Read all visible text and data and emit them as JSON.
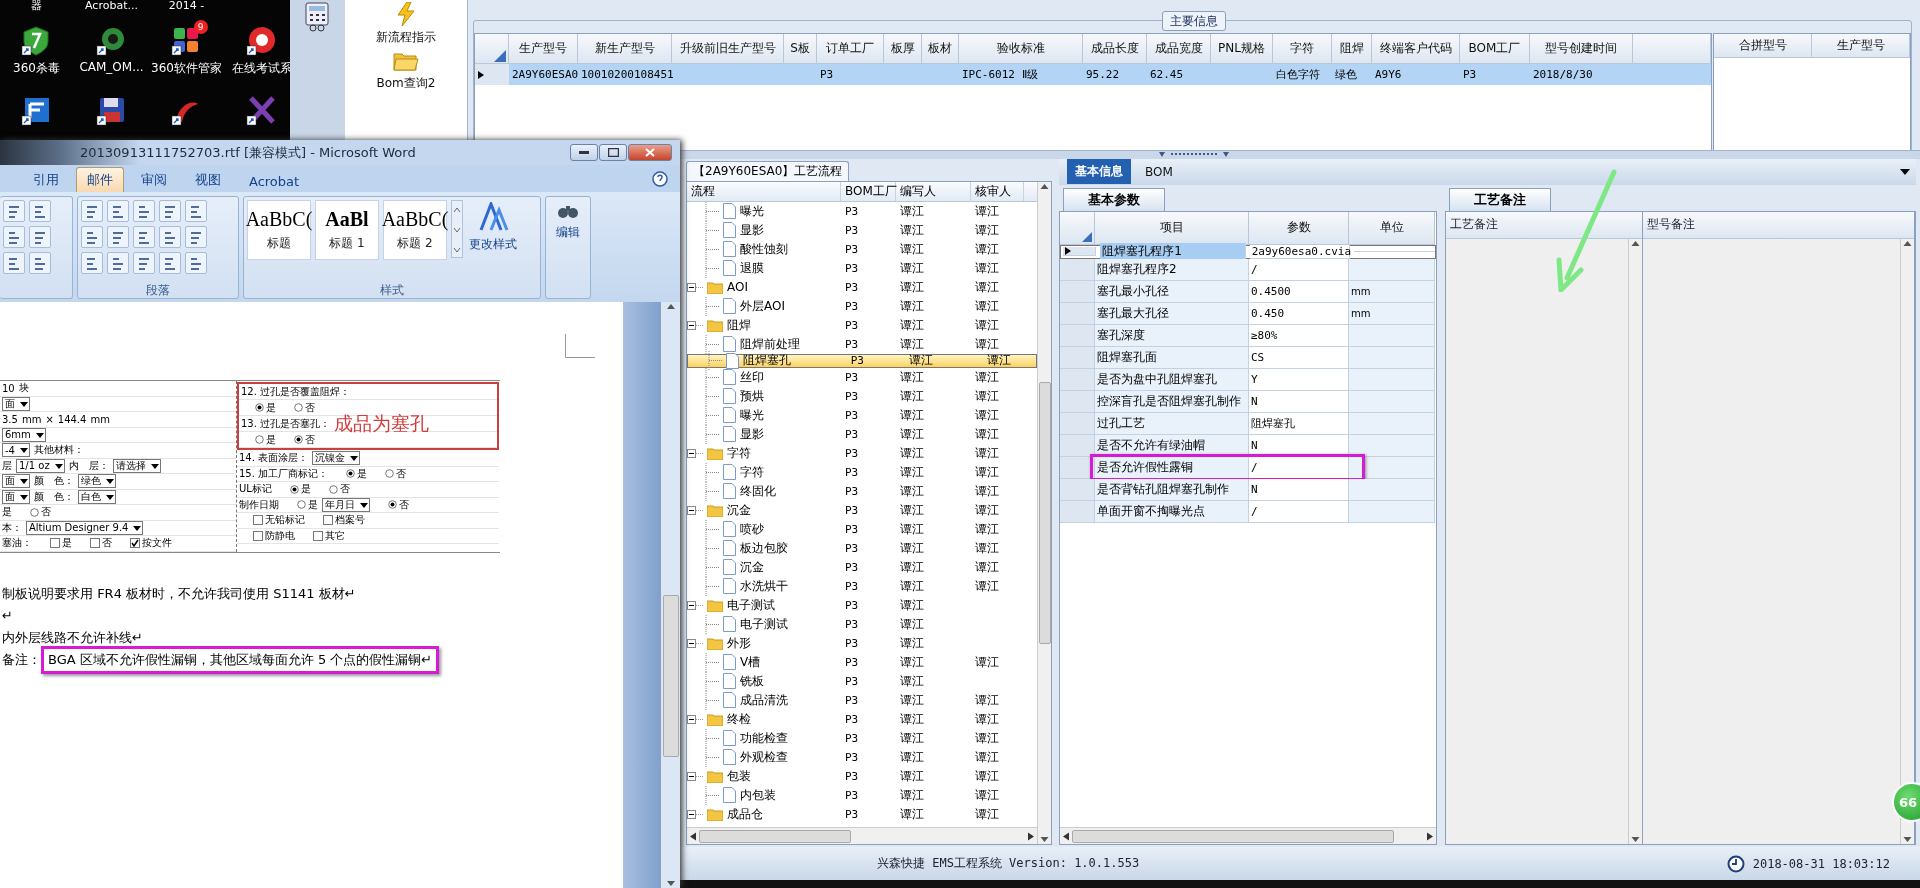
{
  "desktop": {
    "top_labels": [
      "器",
      "Acrobat...",
      "2014 -"
    ],
    "icons": [
      {
        "kind": "shield",
        "label": "360杀毒"
      },
      {
        "kind": "cam",
        "label": "CAM_OM..."
      },
      {
        "kind": "apps",
        "label": "360软件管家",
        "badge": "9"
      },
      {
        "kind": "exam",
        "label": "在线考试系"
      },
      {
        "kind": "edge"
      },
      {
        "kind": "floppy"
      },
      {
        "kind": "swirl"
      },
      {
        "kind": "cross"
      }
    ]
  },
  "app": {
    "toolbar": [
      {
        "kind": "calculator"
      },
      {
        "kind": "flash",
        "label": "新流程指示"
      },
      {
        "kind": "folder",
        "label": "Bom查询2"
      }
    ],
    "main_info": {
      "title": "主要信息",
      "columns": [
        "生产型号",
        "新生产型号",
        "升级前旧生产型号",
        "S板",
        "订单工厂",
        "板厚",
        "板材",
        "验收标准",
        "成品长度",
        "成品宽度",
        "PNL规格",
        "字符",
        "阻焊",
        "终端客户代码",
        "BOM工厂",
        "型号创建时间"
      ],
      "rows": [
        {
          "selected": true,
          "cells": [
            "2A9Y60ESA0",
            "10010200108451",
            null,
            null,
            "P3",
            null,
            null,
            "IPC-6012 Ⅱ级",
            "95.22",
            "62.45",
            null,
            "白色字符",
            "绿色",
            "A9Y6",
            "P3",
            "2018/8/30"
          ]
        }
      ]
    },
    "merge_table": {
      "columns": [
        "合拼型号",
        "生产型号"
      ]
    },
    "process": {
      "title": "【2A9Y60ESA0】工艺流程",
      "columns": [
        "流程",
        "BOM工厂",
        "编写人",
        "核审人"
      ],
      "nodes": [
        {
          "kind": "file",
          "label": "曝光",
          "bom": "P3",
          "writer": "谭江",
          "reviewer": "谭江",
          "selected": false
        },
        {
          "kind": "file",
          "label": "显影",
          "bom": "P3",
          "writer": "谭江",
          "reviewer": "谭江",
          "selected": false
        },
        {
          "kind": "file",
          "label": "酸性蚀刻",
          "bom": "P3",
          "writer": "谭江",
          "reviewer": "谭江",
          "selected": false
        },
        {
          "kind": "file",
          "label": "退膜",
          "bom": "P3",
          "writer": "谭江",
          "reviewer": "谭江",
          "selected": false
        },
        {
          "kind": "folder",
          "label": "AOI",
          "bom": "P3",
          "writer": "谭江",
          "reviewer": "谭江",
          "selected": false,
          "expanded": true,
          "children": [
            {
              "kind": "file",
              "label": "外层AOI",
              "bom": "P3",
              "writer": "谭江",
              "reviewer": "谭江",
              "selected": false
            }
          ]
        },
        {
          "kind": "folder",
          "label": "阻焊",
          "bom": "P3",
          "writer": "谭江",
          "reviewer": "谭江",
          "selected": false,
          "expanded": true,
          "children": [
            {
              "kind": "file",
              "label": "阻焊前处理",
              "bom": "P3",
              "writer": "谭江",
              "reviewer": "谭江",
              "selected": false
            },
            {
              "kind": "file",
              "label": "阻焊塞孔",
              "bom": "P3",
              "writer": "谭江",
              "reviewer": "谭江",
              "selected": true
            },
            {
              "kind": "file",
              "label": "丝印",
              "bom": "P3",
              "writer": "谭江",
              "reviewer": "谭江",
              "selected": false
            },
            {
              "kind": "file",
              "label": "预烘",
              "bom": "P3",
              "writer": "谭江",
              "reviewer": "谭江",
              "selected": false
            },
            {
              "kind": "file",
              "label": "曝光",
              "bom": "P3",
              "writer": "谭江",
              "reviewer": "谭江",
              "selected": false
            },
            {
              "kind": "file",
              "label": "显影",
              "bom": "P3",
              "writer": "谭江",
              "reviewer": "谭江",
              "selected": false
            }
          ]
        },
        {
          "kind": "folder",
          "label": "字符",
          "bom": "P3",
          "writer": "谭江",
          "reviewer": "谭江",
          "selected": false,
          "expanded": true,
          "children": [
            {
              "kind": "file",
              "label": "字符",
              "bom": "P3",
              "writer": "谭江",
              "reviewer": "谭江",
              "selected": false
            },
            {
              "kind": "file",
              "label": "终固化",
              "bom": "P3",
              "writer": "谭江",
              "reviewer": "谭江",
              "selected": false
            }
          ]
        },
        {
          "kind": "folder",
          "label": "沉金",
          "bom": "P3",
          "writer": "谭江",
          "reviewer": "谭江",
          "selected": false,
          "expanded": true,
          "children": [
            {
              "kind": "file",
              "label": "喷砂",
              "bom": "P3",
              "writer": "谭江",
              "reviewer": "谭江",
              "selected": false
            },
            {
              "kind": "file",
              "label": "板边包胶",
              "bom": "P3",
              "writer": "谭江",
              "reviewer": "谭江",
              "selected": false
            },
            {
              "kind": "file",
              "label": "沉金",
              "bom": "P3",
              "writer": "谭江",
              "reviewer": "谭江",
              "selected": false
            },
            {
              "kind": "file",
              "label": "水洗烘干",
              "bom": "P3",
              "writer": "谭江",
              "reviewer": "谭江",
              "selected": false
            }
          ]
        },
        {
          "kind": "folder",
          "label": "电子测试",
          "bom": "P3",
          "writer": "谭江",
          "selected": false,
          "expanded": true,
          "children": [
            {
              "kind": "file",
              "label": "电子测试",
              "bom": "P3",
              "writer": "谭江",
              "selected": false
            }
          ]
        },
        {
          "kind": "folder",
          "label": "外形",
          "bom": "P3",
          "writer": "谭江",
          "selected": false,
          "expanded": true,
          "children": [
            {
              "kind": "file",
              "label": "V槽",
              "bom": "P3",
              "writer": "谭江",
              "reviewer": "谭江",
              "selected": false
            },
            {
              "kind": "file",
              "label": "铣板",
              "bom": "P3",
              "writer": "谭江",
              "selected": false
            },
            {
              "kind": "file",
              "label": "成品清洗",
              "bom": "P3",
              "writer": "谭江",
              "reviewer": "谭江",
              "selected": false
            }
          ]
        },
        {
          "kind": "folder",
          "label": "终检",
          "bom": "P3",
          "writer": "谭江",
          "reviewer": "谭江",
          "selected": false,
          "expanded": true,
          "children": [
            {
              "kind": "file",
              "label": "功能检查",
              "bom": "P3",
              "writer": "谭江",
              "reviewer": "谭江",
              "selected": false
            },
            {
              "kind": "file",
              "label": "外观检查",
              "bom": "P3",
              "writer": "谭江",
              "reviewer": "谭江",
              "selected": false
            }
          ]
        },
        {
          "kind": "folder",
          "label": "包装",
          "bom": "P3",
          "writer": "谭江",
          "reviewer": "谭江",
          "selected": false,
          "expanded": true,
          "children": [
            {
              "kind": "file",
              "label": "内包装",
              "bom": "P3",
              "writer": "谭江",
              "reviewer": "谭江",
              "selected": false
            }
          ]
        },
        {
          "kind": "folder",
          "label": "成品仓",
          "bom": "P3",
          "writer": "谭江",
          "reviewer": "谭江",
          "selected": false,
          "expanded": true
        }
      ]
    },
    "detail": {
      "tabs": [
        {
          "label": "基本信息",
          "selected": true
        },
        {
          "label": "BOM",
          "selected": false
        }
      ],
      "params": {
        "tab": "基本参数",
        "columns": [
          "项目",
          "参数",
          "单位"
        ],
        "rows": [
          {
            "item": "阻焊塞孔程序1",
            "value": "2a9y60esa0.cvia",
            "selected": true,
            "highlighted": false
          },
          {
            "item": "阻焊塞孔程序2",
            "value": "/",
            "selected": false,
            "highlighted": false
          },
          {
            "item": "塞孔最小孔径",
            "value": "0.4500",
            "unit": "mm",
            "selected": false,
            "highlighted": false
          },
          {
            "item": "塞孔最大孔径",
            "value": "0.450",
            "unit": "mm",
            "selected": false,
            "highlighted": false
          },
          {
            "item": "塞孔深度",
            "value": "≥80%",
            "selected": false,
            "highlighted": false
          },
          {
            "item": "阻焊塞孔面",
            "value": "CS",
            "selected": false,
            "highlighted": false
          },
          {
            "item": "是否为盘中孔阻焊塞孔",
            "value": "Y",
            "selected": false,
            "highlighted": false
          },
          {
            "item": "控深盲孔是否阻焊塞孔制作",
            "value": "N",
            "selected": false,
            "highlighted": false
          },
          {
            "item": "过孔工艺",
            "value": "阻焊塞孔",
            "selected": false,
            "highlighted": false
          },
          {
            "item": "是否不允许有绿油帽",
            "value": "N",
            "selected": false,
            "highlighted": false
          },
          {
            "item": "是否允许假性露铜",
            "value": "/",
            "selected": false,
            "highlighted": true
          },
          {
            "item": "是否背钻孔阻焊塞孔制作",
            "value": "N",
            "selected": false,
            "highlighted": false
          },
          {
            "item": "单面开窗不掏曝光点",
            "value": "/",
            "selected": false,
            "highlighted": false
          }
        ]
      },
      "notes": {
        "tab": "工艺备注",
        "columns": [
          "工艺备注",
          "型号备注"
        ]
      }
    },
    "status_bar": {
      "version": "兴森快捷 EMS工程系统 Version: 1.0.1.553",
      "datetime": "2018-08-31 18:03:12"
    },
    "badge": "66"
  },
  "word": {
    "title": "20130913111752703.rtf [兼容模式] - Microsoft Word",
    "tabs": [
      {
        "label": "引用",
        "selected": false
      },
      {
        "label": "邮件",
        "selected": true
      },
      {
        "label": "审阅",
        "selected": false
      },
      {
        "label": "视图",
        "selected": false
      },
      {
        "label": "Acrobat",
        "selected": false
      }
    ],
    "paragraph_group": "段落",
    "styles_group": "样式",
    "styles": [
      {
        "sample": "AaBbC(",
        "name": "标题"
      },
      {
        "sample": "AaBl",
        "name": "标题 1"
      },
      {
        "sample": "AaBbC(",
        "name": "标题 2"
      }
    ],
    "change_styles": "更改样式",
    "editing": "编辑",
    "form": {
      "left_rows": [
        [
          {
            "kind": "text",
            "text": "10"
          },
          {
            "kind": "text",
            "text": "块"
          }
        ],
        [
          {
            "kind": "select",
            "text": "面"
          }
        ],
        [
          {
            "kind": "text",
            "text": "3.5"
          },
          {
            "kind": "text",
            "text": "mm"
          },
          {
            "kind": "text",
            "text": "×"
          },
          {
            "kind": "text",
            "text": "144.4"
          },
          {
            "kind": "text",
            "text": "mm"
          }
        ],
        [
          {
            "kind": "select",
            "text": "6mm"
          }
        ],
        [
          {
            "kind": "select",
            "text": "-4"
          },
          {
            "kind": "text",
            "text": "其他材料："
          }
        ],
        [
          {
            "kind": "text",
            "text": "层"
          },
          {
            "kind": "select",
            "text": "1/1 oz"
          },
          {
            "kind": "text",
            "text": "内　层："
          },
          {
            "kind": "select",
            "text": "请选择"
          }
        ],
        [
          {
            "kind": "select",
            "text": "面"
          },
          {
            "kind": "text",
            "text": "颜　色："
          },
          {
            "kind": "select",
            "text": "绿色"
          }
        ],
        [
          {
            "kind": "select",
            "text": "面"
          },
          {
            "kind": "text",
            "text": "颜　色："
          },
          {
            "kind": "select",
            "text": "白色"
          }
        ],
        [
          {
            "kind": "text",
            "text": "是"
          },
          {
            "kind": "radio",
            "text": "否",
            "checked": false
          }
        ],
        [
          {
            "kind": "text",
            "text": "本："
          },
          {
            "kind": "select",
            "text": "Altium Designer 9.4"
          }
        ],
        [
          {
            "kind": "text",
            "text": "塞油："
          },
          {
            "kind": "check",
            "text": "是",
            "checked": false
          },
          {
            "kind": "check",
            "text": "否",
            "checked": false
          },
          {
            "kind": "check",
            "text": "按文件",
            "checked": true
          }
        ]
      ],
      "boxed_rows": [
        [
          {
            "kind": "text",
            "text": "12. 过孔是否覆盖阻焊："
          }
        ],
        [
          {
            "kind": "radio",
            "text": "是",
            "checked": true
          },
          {
            "kind": "radio",
            "text": "否",
            "checked": false
          }
        ],
        [
          {
            "kind": "text",
            "text": "13. 过孔是否塞孔："
          },
          {
            "kind": "stamp",
            "text": "成品为塞孔"
          }
        ],
        [
          {
            "kind": "radio",
            "text": "是",
            "checked": false
          },
          {
            "kind": "radio",
            "text": "否",
            "checked": true
          }
        ]
      ],
      "right_rows": [
        [
          {
            "kind": "text",
            "text": "14. 表面涂层："
          },
          {
            "kind": "select",
            "text": "沉镍金"
          }
        ],
        [
          {
            "kind": "text",
            "text": "15. 加工厂商标记："
          },
          {
            "kind": "radio",
            "text": "是",
            "checked": true
          },
          {
            "kind": "radio",
            "text": "否",
            "checked": false
          }
        ],
        [
          {
            "kind": "text",
            "text": "UL标记"
          },
          {
            "kind": "radio",
            "text": "是",
            "checked": true
          },
          {
            "kind": "radio",
            "text": "否",
            "checked": false
          }
        ],
        [
          {
            "kind": "text",
            "text": "制作日期"
          },
          {
            "kind": "radio",
            "text": "是",
            "checked": false
          },
          {
            "kind": "select",
            "text": "年月日"
          },
          {
            "kind": "radio",
            "text": "否",
            "checked": true
          }
        ],
        [
          {
            "kind": "check",
            "text": "无铅标记",
            "checked": false
          },
          {
            "kind": "check",
            "text": "档案号",
            "checked": false
          }
        ],
        [
          {
            "kind": "check",
            "text": "防静电",
            "checked": false
          },
          {
            "kind": "check",
            "text": "其它",
            "checked": false
          }
        ]
      ]
    },
    "paragraphs": [
      {
        "text": "制板说明要求用 FR4 板材时，不允许我司使用 S1141 板材↵",
        "highlighted": false
      },
      {
        "text": "↵",
        "highlighted": false
      },
      {
        "text": "内外层线路不允许补线↵",
        "highlighted": false
      },
      {
        "label": "备注：",
        "text": "BGA 区域不允许假性漏铜，其他区域每面允许 5 个点的假性漏铜↵",
        "highlighted": true
      }
    ]
  }
}
